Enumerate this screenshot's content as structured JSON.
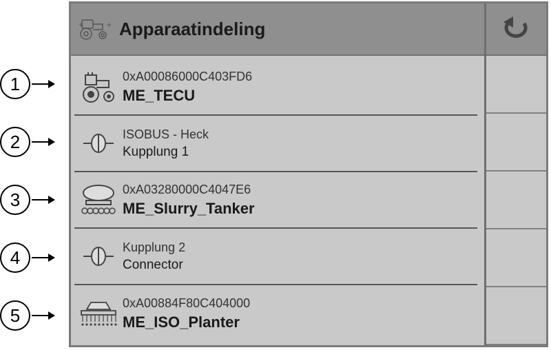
{
  "header": {
    "title": "Apparaatindeling"
  },
  "callouts": [
    "1",
    "2",
    "3",
    "4",
    "5"
  ],
  "rows": [
    {
      "line1": "0xA00086000C403FD6",
      "line2": "ME_TECU",
      "bold": true,
      "icon": "tractor-icon"
    },
    {
      "line1": "ISOBUS - Heck",
      "line2": "Kupplung 1",
      "bold": false,
      "icon": "coupling-icon"
    },
    {
      "line1": "0xA03280000C4047E6",
      "line2": "ME_Slurry_Tanker",
      "bold": true,
      "icon": "tanker-icon"
    },
    {
      "line1": "Kupplung 2",
      "line2": "Connector",
      "bold": false,
      "icon": "coupling-icon"
    },
    {
      "line1": "0xA00884F80C404000",
      "line2": "ME_ISO_Planter",
      "bold": true,
      "icon": "planter-icon"
    }
  ]
}
